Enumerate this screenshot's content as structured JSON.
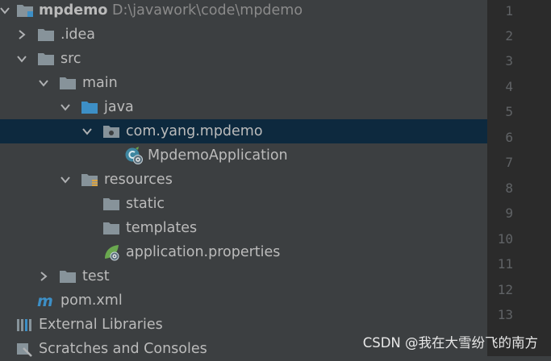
{
  "project": {
    "name": "mpdemo",
    "path": "D:\\javawork\\code\\mpdemo"
  },
  "tree": {
    "idea": ".idea",
    "src": "src",
    "main": "main",
    "java": "java",
    "package": "com.yang.mpdemo",
    "app_class": "MpdemoApplication",
    "resources": "resources",
    "static": "static",
    "templates": "templates",
    "properties": "application.properties",
    "test": "test",
    "pom": "pom.xml",
    "external_libraries": "External Libraries",
    "scratches": "Scratches and Consoles"
  },
  "gutter": {
    "line_numbers": [
      "1",
      "2",
      "3",
      "4",
      "5",
      "6",
      "7",
      "8",
      "9",
      "10",
      "11",
      "12",
      "13"
    ]
  },
  "watermark": "CSDN @我在大雪纷飞的南方",
  "colors": {
    "panel_bg": "#3c3f41",
    "editor_bg": "#2b2b2b",
    "selection": "#0d293e",
    "folder": "#87939a",
    "source_folder": "#3d8fc6",
    "text": "#bbbbbb",
    "line_number": "#606366"
  }
}
